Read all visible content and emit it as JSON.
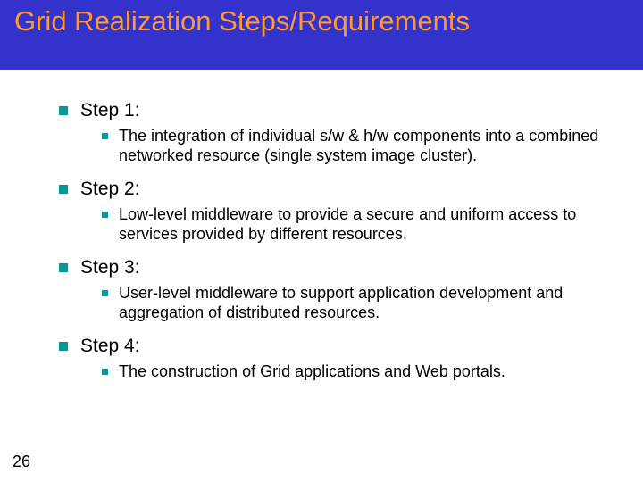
{
  "title": "Grid Realization Steps/Requirements",
  "steps": [
    {
      "label": "Step 1:",
      "detail": "The integration of individual s/w & h/w components into a combined networked resource (single system image cluster)."
    },
    {
      "label": "Step 2:",
      "detail": "Low-level middleware to provide a secure and uniform access to services provided by different resources."
    },
    {
      "label": "Step 3:",
      "detail": "User-level middleware to support application development and aggregation of distributed resources."
    },
    {
      "label": "Step 4:",
      "detail": "The construction of Grid applications and Web portals."
    }
  ],
  "page_number": "26"
}
